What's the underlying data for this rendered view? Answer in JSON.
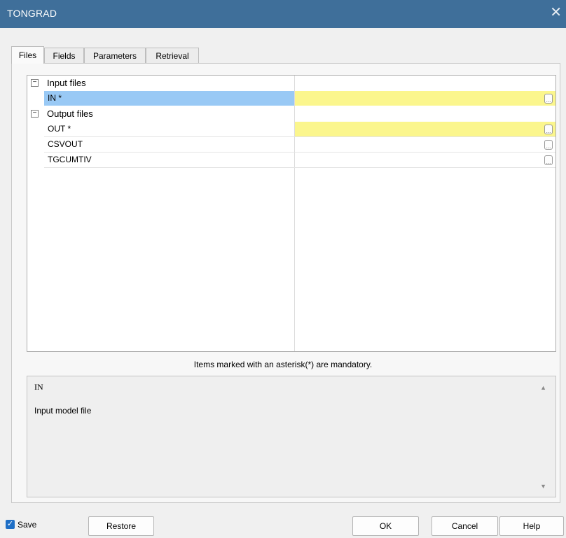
{
  "window": {
    "title": "TONGRAD",
    "close_glyph": "✕"
  },
  "tabs": [
    {
      "label": "Files",
      "active": true
    },
    {
      "label": "Fields",
      "active": false
    },
    {
      "label": "Parameters",
      "active": false
    },
    {
      "label": "Retrieval",
      "active": false
    }
  ],
  "grid": {
    "toggle_glyph": "−",
    "ellipsis_glyph": "...",
    "categories": [
      {
        "label": "Input files",
        "rows": [
          {
            "name": "IN *",
            "value": "",
            "mandatory": true,
            "selected": true
          }
        ]
      },
      {
        "label": "Output files",
        "rows": [
          {
            "name": "OUT *",
            "value": "",
            "mandatory": true,
            "selected": false
          },
          {
            "name": "CSVOUT",
            "value": "",
            "mandatory": false,
            "selected": false
          },
          {
            "name": "TGCUMTIV",
            "value": "",
            "mandatory": false,
            "selected": false
          }
        ]
      }
    ]
  },
  "hint": "Items marked with an asterisk(*) are mandatory.",
  "description": {
    "title": "IN",
    "body": "Input model file",
    "scroll_up_glyph": "▲",
    "scroll_down_glyph": "▼"
  },
  "footer": {
    "save_label": "Save",
    "save_checked": true,
    "check_glyph": "✓",
    "restore_label": "Restore",
    "ok_label": "OK",
    "cancel_label": "Cancel",
    "help_label": "Help"
  },
  "colors": {
    "titlebar": "#3f6f9a",
    "selection": "#99c9f5",
    "mandatory": "#fbf68d",
    "checkbox": "#1f6fc6"
  }
}
